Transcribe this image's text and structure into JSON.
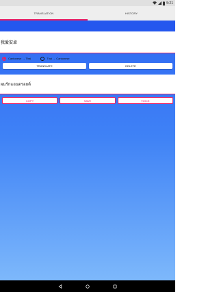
{
  "status_bar": {
    "time": "5:21",
    "icons": [
      "wifi-icon",
      "signal-icon",
      "battery-icon"
    ]
  },
  "tabs": [
    {
      "label": "TRANSLATION",
      "active": true
    },
    {
      "label": "HISTORY",
      "active": false
    }
  ],
  "source": {
    "text": "我爱安卓"
  },
  "directions": [
    {
      "label": "Cantonese → Thai",
      "checked": true
    },
    {
      "label": "Thai → Cantonese",
      "checked": false
    }
  ],
  "buttons": {
    "translate": "TRANSLATE",
    "delete": "DELETE"
  },
  "result": {
    "text": "ผมรักแอนดรอยด์"
  },
  "actions": {
    "copy": "COPY",
    "save": "SAVE",
    "voice": "VOICE"
  },
  "colors": {
    "accent": "#e91e63",
    "primary": "#2457ee"
  },
  "nav": {
    "icons": [
      "back-icon",
      "home-icon",
      "recents-icon"
    ]
  }
}
